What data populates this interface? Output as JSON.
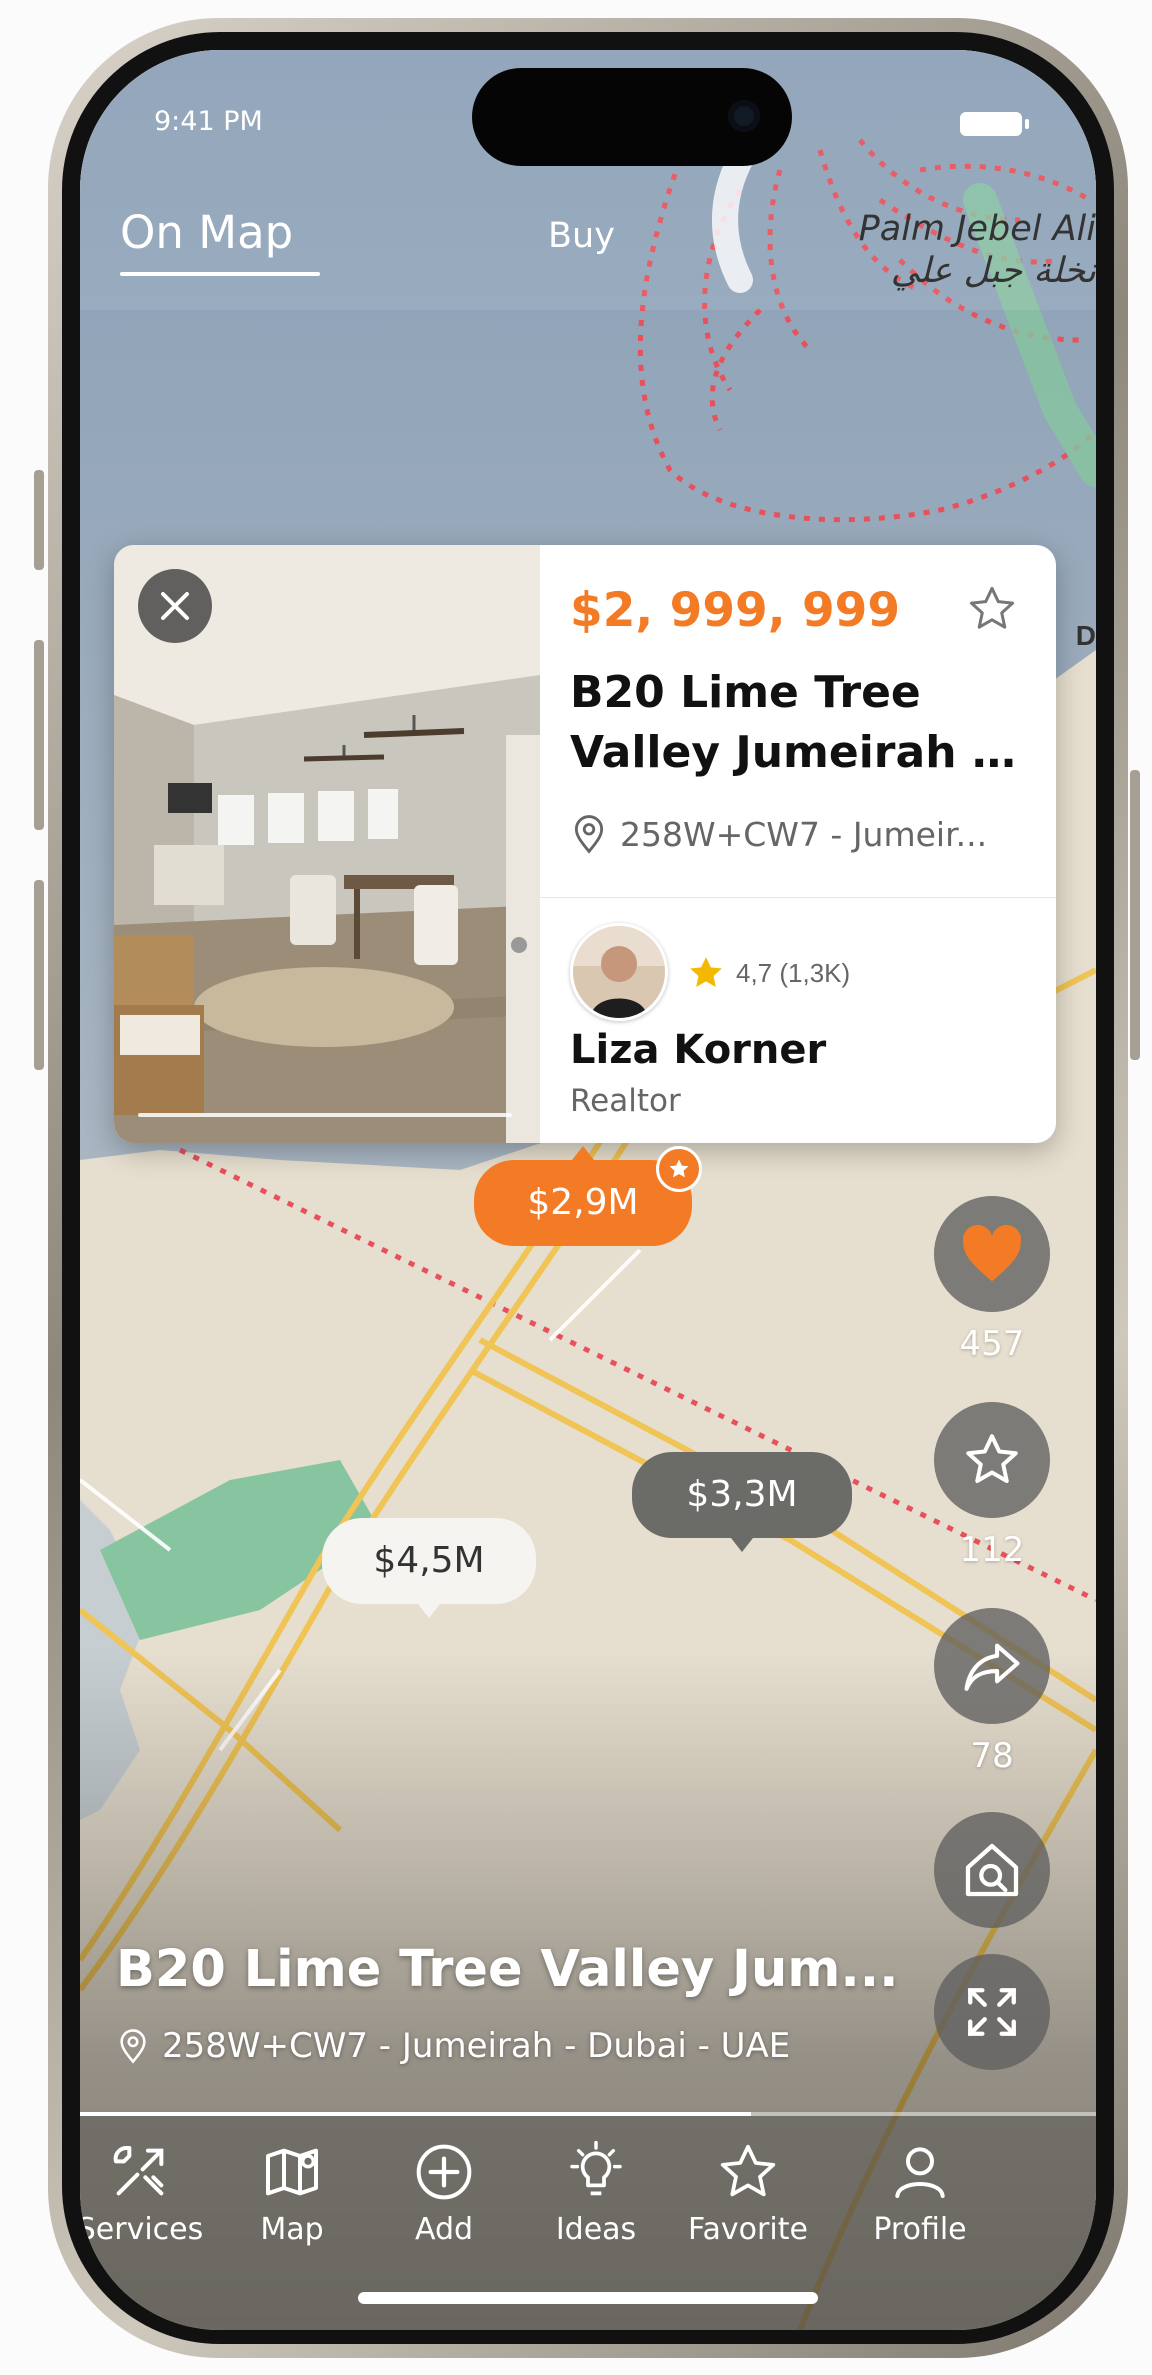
{
  "status_bar": {
    "time": "9:41 PM"
  },
  "top_tabs": [
    {
      "label": "On Map",
      "active": true
    },
    {
      "label": "Buy",
      "active": false
    }
  ],
  "map": {
    "place_label_en": "Palm Jebel Ali",
    "place_label_ar": "نخلة جبل علي",
    "edge_label": "D",
    "price_pins": [
      {
        "label": "$2,9M",
        "style": "selected",
        "starred": true
      },
      {
        "label": "$3,3M",
        "style": "dark"
      },
      {
        "label": "$4,5M",
        "style": "light"
      }
    ]
  },
  "card": {
    "price": "$2, 999, 999",
    "title_line1": "B20 Lime Tree",
    "title_line2": "Valley Jumeirah G...",
    "address": "258W+CW7 - Jumeir...",
    "agent": {
      "name": "Liza Korner",
      "role": "Realtor",
      "rating": "4,7 (1,3K)"
    }
  },
  "actions": [
    {
      "icon": "heart-icon",
      "count": "457",
      "active": true
    },
    {
      "icon": "star-icon",
      "count": "112"
    },
    {
      "icon": "share-icon",
      "count": "78"
    },
    {
      "icon": "home-search-icon"
    },
    {
      "icon": "expand-icon"
    }
  ],
  "listing": {
    "title": "B20 Lime Tree Valley Jum...",
    "address": "258W+CW7 - Jumeirah - Dubai - UAE"
  },
  "bottom_nav": [
    {
      "label": "Services",
      "icon": "services-icon"
    },
    {
      "label": "Map",
      "icon": "map-icon"
    },
    {
      "label": "Add",
      "icon": "add-icon"
    },
    {
      "label": "Ideas",
      "icon": "lightbulb-icon"
    },
    {
      "label": "Favorite",
      "icon": "star-icon"
    },
    {
      "label": "Profile",
      "icon": "profile-icon"
    }
  ],
  "colors": {
    "accent": "#F47B25",
    "rating_star": "#F5B800",
    "water": "#8FA3B6",
    "land": "#E5DDCC",
    "park": "#86C59F",
    "road": "#F0C455",
    "palm_outline": "#E8505B"
  }
}
